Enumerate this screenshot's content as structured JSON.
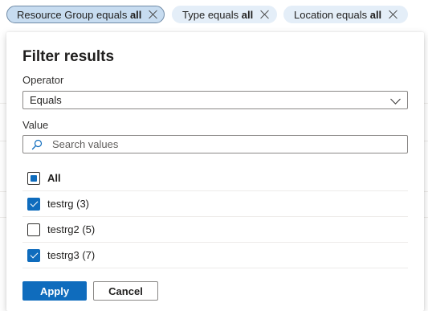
{
  "filter_pills": [
    {
      "field": "Resource Group",
      "operator": "equals",
      "value": "all",
      "active": true
    },
    {
      "field": "Type",
      "operator": "equals",
      "value": "all",
      "active": false
    },
    {
      "field": "Location",
      "operator": "equals",
      "value": "all",
      "active": false
    }
  ],
  "panel": {
    "title": "Filter results",
    "operator_label": "Operator",
    "operator_value": "Equals",
    "value_label": "Value",
    "search_placeholder": "Search values",
    "options": [
      {
        "label": "All",
        "state": "indeterminate",
        "bold": true
      },
      {
        "label": "testrg (3)",
        "state": "checked",
        "bold": false
      },
      {
        "label": "testrg2 (5)",
        "state": "unchecked",
        "bold": false
      },
      {
        "label": "testrg3 (7)",
        "state": "checked",
        "bold": false
      }
    ],
    "apply_label": "Apply",
    "cancel_label": "Cancel"
  },
  "colors": {
    "accent": "#0f6cbd",
    "pill_bg": "#e4eef8",
    "pill_active_bg": "#c7dcf0"
  },
  "icons": {
    "pill_close": "close-icon",
    "select_chevron": "chevron-down-icon",
    "search": "search-icon"
  }
}
